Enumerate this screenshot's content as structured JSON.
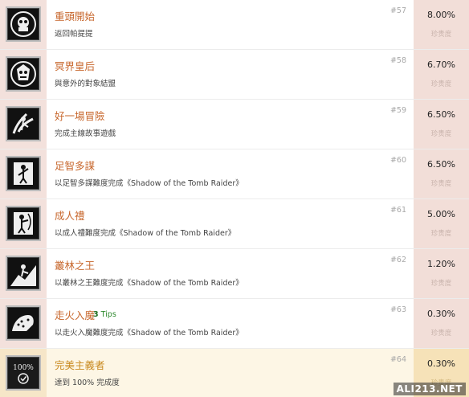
{
  "achievements": [
    {
      "title": "重頭開始",
      "description": "返回帕提提",
      "number": "#57",
      "percent": "8.00%",
      "sub": "珍贵度"
    },
    {
      "title": "冥界皇后",
      "description": "與意外的對象結盟",
      "number": "#58",
      "percent": "6.70%",
      "sub": "珍贵度"
    },
    {
      "title": "好一場冒險",
      "description": "完成主線故事遊戲",
      "number": "#59",
      "percent": "6.50%",
      "sub": "珍贵度"
    },
    {
      "title": "足智多謀",
      "description": "以足智多謀難度完成《Shadow of the Tomb Raider》",
      "number": "#60",
      "percent": "6.50%",
      "sub": "珍贵度"
    },
    {
      "title": "成人禮",
      "description": "以成人禮難度完成《Shadow of the Tomb Raider》",
      "number": "#61",
      "percent": "5.00%",
      "sub": "珍贵度"
    },
    {
      "title": "叢林之王",
      "description": "以叢林之王難度完成《Shadow of the Tomb Raider》",
      "number": "#62",
      "percent": "1.20%",
      "sub": "珍贵度"
    },
    {
      "title": "走火入魔",
      "description": "以走火入魔難度完成《Shadow of the Tomb Raider》",
      "number": "#63",
      "percent": "0.30%",
      "sub": "珍贵度",
      "tips_count": "3",
      "tips_label": "Tips"
    },
    {
      "title": "完美主義者",
      "description": "達到 100% 完成度",
      "number": "#64",
      "percent": "0.30%",
      "sub": "珍贵度",
      "icon_text": "100%"
    }
  ],
  "icons": [
    "skull-emblem-icon",
    "queen-mask-icon",
    "explorer-icon",
    "climber-icon",
    "archer-icon",
    "jungle-warrior-icon",
    "jaguar-icon",
    "perfectionist-badge-icon"
  ],
  "colors": {
    "title": "#c7662b",
    "gold_title": "#c98a20",
    "tips": "#2f8a2f",
    "pct_column": "#f2ded8",
    "left_strip": "#f3e1dc"
  },
  "watermark": "ALI213.NET"
}
